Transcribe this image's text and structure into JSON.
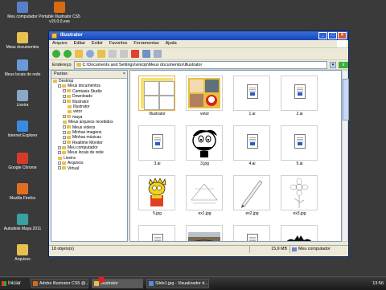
{
  "desktop": {
    "icons": [
      {
        "label": "Meu computador",
        "color": "#5a7fc8"
      },
      {
        "label": "Portable Illustrator CS5 v15.0.0.exe",
        "color": "#d86a10"
      },
      {
        "label": "Meus documentos",
        "color": "#e8c050"
      },
      {
        "label": "Meus locais de rede",
        "color": "#6a9ad8"
      },
      {
        "label": "Lixeira",
        "color": "#8aa8c8"
      },
      {
        "label": "Internet Explorer",
        "color": "#3a8ae0"
      },
      {
        "label": "Google Chrome",
        "color": "#d83a2a"
      },
      {
        "label": "Mozilla Firefox",
        "color": "#e07020"
      },
      {
        "label": "Autodesk Maya 2011",
        "color": "#3aa0a0"
      },
      {
        "label": "Arquivos",
        "color": "#e8c050"
      }
    ]
  },
  "window": {
    "title": "Illustrator",
    "menu": [
      "Arquivo",
      "Editar",
      "Exibir",
      "Favoritos",
      "Ferramentas",
      "Ajuda"
    ],
    "address_label": "Endereço",
    "address_value": "C:\\Documents and Settings\\vinicip\\Meus documentos\\Illustrator",
    "go_label": "Ir",
    "tree_header": "Pastas",
    "tree": [
      {
        "label": "Desktop",
        "indent": 0,
        "pm": false
      },
      {
        "label": "Meus documentos",
        "indent": 1,
        "pm": true
      },
      {
        "label": "Camtasia Studio",
        "indent": 2,
        "pm": true
      },
      {
        "label": "Downloads",
        "indent": 2,
        "pm": true
      },
      {
        "label": "Illustrator",
        "indent": 2,
        "pm": true
      },
      {
        "label": "Illustrator",
        "indent": 3,
        "pm": false
      },
      {
        "label": "vetor",
        "indent": 3,
        "pm": false
      },
      {
        "label": "maya",
        "indent": 2,
        "pm": true
      },
      {
        "label": "Meus arquivos recebidos",
        "indent": 2,
        "pm": false
      },
      {
        "label": "Meus vídeos",
        "indent": 2,
        "pm": true
      },
      {
        "label": "Minhas imagens",
        "indent": 2,
        "pm": true
      },
      {
        "label": "Minhas músicas",
        "indent": 2,
        "pm": true
      },
      {
        "label": "Realtime Monitor",
        "indent": 2,
        "pm": true
      },
      {
        "label": "Meu computador",
        "indent": 1,
        "pm": true
      },
      {
        "label": "Meus locais de rede",
        "indent": 1,
        "pm": true
      },
      {
        "label": "Lixeira",
        "indent": 1,
        "pm": false
      },
      {
        "label": "Arquivos",
        "indent": 1,
        "pm": true
      },
      {
        "label": "Virtual",
        "indent": 1,
        "pm": true
      }
    ],
    "files": [
      {
        "name": "Illustrator",
        "kind": "illus",
        "selected": true
      },
      {
        "name": "vetor",
        "kind": "photo",
        "selected": false
      },
      {
        "name": "1.ai",
        "kind": "doc",
        "selected": false
      },
      {
        "name": "2.ai",
        "kind": "doc",
        "selected": false
      },
      {
        "name": "3.ai",
        "kind": "doc",
        "selected": false
      },
      {
        "name": "3.jpg",
        "kind": "cartoon",
        "selected": false
      },
      {
        "name": "4.ai",
        "kind": "doc",
        "selected": false
      },
      {
        "name": "5.ai",
        "kind": "doc",
        "selected": false
      },
      {
        "name": "5.jpg",
        "kind": "lisa",
        "selected": false
      },
      {
        "name": "ex1.jpg",
        "kind": "sketch",
        "selected": false
      },
      {
        "name": "ex2.jpg",
        "kind": "pencil",
        "selected": false
      },
      {
        "name": "ex3.jpg",
        "kind": "flower",
        "selected": false
      },
      {
        "name": "",
        "kind": "doc",
        "selected": false
      },
      {
        "name": "",
        "kind": "landscape",
        "selected": false
      },
      {
        "name": "",
        "kind": "doc",
        "selected": false
      },
      {
        "name": "",
        "kind": "bat",
        "selected": false
      }
    ],
    "status": {
      "objects": "18 objeto(s)",
      "size": "15,9 MB",
      "location": "Meu computador"
    }
  },
  "taskbar": {
    "start_label": "Iniciar",
    "buttons": [
      {
        "label": "Adobe Illustrator CS5 @...",
        "active": false,
        "color": "#d86a10"
      },
      {
        "label": "Illustrator",
        "active": true,
        "color": "#e8c050"
      },
      {
        "label": "Slide1.jpg - Visualizador d...",
        "active": false,
        "color": "#5a8ad8"
      }
    ],
    "clock": "13:56"
  }
}
